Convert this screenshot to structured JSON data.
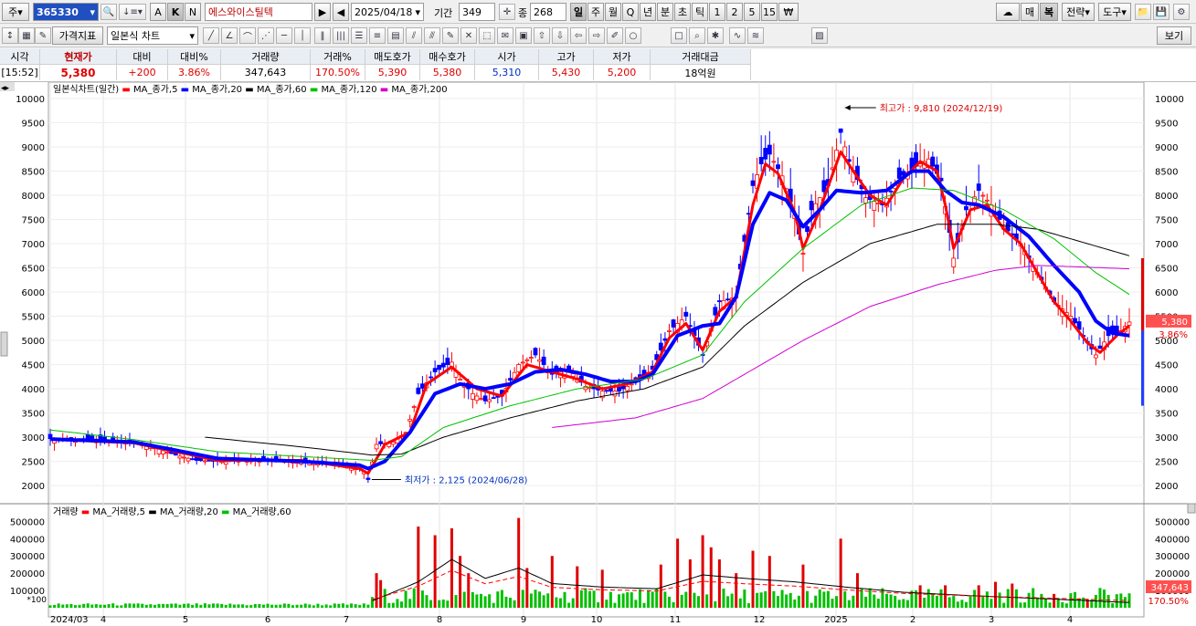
{
  "toolbar1": {
    "code_prefix": "주",
    "stock_code": "365330",
    "stock_name": "에스와이스틸텍",
    "date": "2025/04/18",
    "period_label": "기간",
    "period_value": "349",
    "jong_label": "종",
    "jong_value": "268",
    "buttons": [
      "A",
      "K",
      "N"
    ],
    "timeframes": [
      "일",
      "주",
      "월",
      "Q",
      "년",
      "분",
      "초",
      "틱",
      "1",
      "2",
      "5",
      "15",
      "₩"
    ],
    "right_buttons": [
      "매",
      "복",
      "전략",
      "도구"
    ]
  },
  "toolbar2": {
    "indicator_button": "가격지표",
    "chart_type_select": "일본식 차트",
    "view_button": "보기"
  },
  "quote": {
    "headers": [
      "시각",
      "현재가",
      "대비",
      "대비%",
      "거래량",
      "거래%",
      "매도호가",
      "매수호가",
      "시가",
      "고가",
      "저가",
      "거래대금"
    ],
    "values": [
      "[15:52]",
      "5,380",
      "+200",
      "3.86%",
      "347,643",
      "170.50%",
      "5,390",
      "5,380",
      "5,310",
      "5,430",
      "5,200",
      "18억원"
    ]
  },
  "price_legend": {
    "title": "일본식차트(일간)",
    "items": [
      {
        "name": "MA_종가,5",
        "color": "#ff0000"
      },
      {
        "name": "MA_종가,20",
        "color": "#0000ff"
      },
      {
        "name": "MA_종가,60",
        "color": "#000000"
      },
      {
        "name": "MA_종가,120",
        "color": "#00c000"
      },
      {
        "name": "MA_종가,200",
        "color": "#d000d0"
      }
    ]
  },
  "volume_legend": {
    "title": "거래량",
    "items": [
      {
        "name": "MA_거래량,5",
        "color": "#ff0000"
      },
      {
        "name": "MA_거래량,20",
        "color": "#000000"
      },
      {
        "name": "MA_거래량,60",
        "color": "#00c000"
      }
    ]
  },
  "annotations": {
    "high": "최고가 : 9,810 (2024/12/19)",
    "low": "최저가 : 2,125 (2024/06/28)",
    "current_price_tag": "5,380",
    "current_pct_tag": "3.86%",
    "current_volume_tag": "347,643",
    "volume_pct_tag": "170.50%",
    "volume_unit": "*100"
  },
  "chart_data": {
    "type": "candlestick",
    "x_tick_labels": [
      "2024/03",
      "4",
      "5",
      "6",
      "7",
      "8",
      "9",
      "10",
      "11",
      "12",
      "2025",
      "2",
      "3",
      "4"
    ],
    "y_ticks": [
      2000,
      2500,
      3000,
      3500,
      4000,
      4500,
      5000,
      5500,
      6000,
      6500,
      7000,
      7500,
      8000,
      8500,
      9000,
      9500,
      10000
    ],
    "ylim": [
      1700,
      10150
    ],
    "volume_ticks": [
      100000,
      200000,
      300000,
      400000,
      500000
    ],
    "volume_ylim": [
      0,
      560000
    ],
    "close_path": [
      [
        0,
        2970
      ],
      [
        10,
        2960
      ],
      [
        20,
        2880
      ],
      [
        25,
        2780
      ],
      [
        30,
        2630
      ],
      [
        35,
        2520
      ],
      [
        42,
        2490
      ],
      [
        48,
        2560
      ],
      [
        55,
        2530
      ],
      [
        62,
        2510
      ],
      [
        68,
        2470
      ],
      [
        73,
        2380
      ],
      [
        75,
        2300
      ],
      [
        76,
        2125
      ],
      [
        78,
        2850
      ],
      [
        82,
        2900
      ],
      [
        85,
        3100
      ],
      [
        88,
        3900
      ],
      [
        92,
        4350
      ],
      [
        96,
        4550
      ],
      [
        98,
        4200
      ],
      [
        101,
        3900
      ],
      [
        104,
        3750
      ],
      [
        108,
        3850
      ],
      [
        112,
        4500
      ],
      [
        116,
        4700
      ],
      [
        120,
        4300
      ],
      [
        124,
        4400
      ],
      [
        128,
        4050
      ],
      [
        132,
        3950
      ],
      [
        136,
        3950
      ],
      [
        140,
        4150
      ],
      [
        144,
        4400
      ],
      [
        148,
        5200
      ],
      [
        152,
        5500
      ],
      [
        156,
        4700
      ],
      [
        160,
        5800
      ],
      [
        164,
        5900
      ],
      [
        168,
        8200
      ],
      [
        170,
        8650
      ],
      [
        172,
        8850
      ],
      [
        175,
        8400
      ],
      [
        178,
        7600
      ],
      [
        180,
        6800
      ],
      [
        182,
        7700
      ],
      [
        186,
        8200
      ],
      [
        189,
        9300
      ],
      [
        191,
        8700
      ],
      [
        195,
        7950
      ],
      [
        199,
        7800
      ],
      [
        203,
        8350
      ],
      [
        207,
        8600
      ],
      [
        210,
        8750
      ],
      [
        213,
        8300
      ],
      [
        216,
        6700
      ],
      [
        219,
        7700
      ],
      [
        222,
        8100
      ],
      [
        225,
        7800
      ],
      [
        228,
        7350
      ],
      [
        232,
        7000
      ],
      [
        236,
        6400
      ],
      [
        240,
        5800
      ],
      [
        244,
        5500
      ],
      [
        248,
        4950
      ],
      [
        250,
        4700
      ],
      [
        253,
        5100
      ],
      [
        256,
        5200
      ],
      [
        258,
        5380
      ]
    ],
    "series": [
      {
        "name": "MA_종가,5",
        "color": "#ff0000",
        "points": [
          [
            0,
            2960
          ],
          [
            20,
            2880
          ],
          [
            40,
            2520
          ],
          [
            60,
            2520
          ],
          [
            74,
            2350
          ],
          [
            76,
            2250
          ],
          [
            80,
            2850
          ],
          [
            86,
            3100
          ],
          [
            90,
            4100
          ],
          [
            96,
            4450
          ],
          [
            102,
            4000
          ],
          [
            108,
            3850
          ],
          [
            114,
            4500
          ],
          [
            120,
            4350
          ],
          [
            126,
            4200
          ],
          [
            132,
            4000
          ],
          [
            138,
            4100
          ],
          [
            144,
            4350
          ],
          [
            148,
            5050
          ],
          [
            152,
            5350
          ],
          [
            156,
            4800
          ],
          [
            160,
            5600
          ],
          [
            164,
            5900
          ],
          [
            168,
            7800
          ],
          [
            171,
            8650
          ],
          [
            174,
            8450
          ],
          [
            178,
            7650
          ],
          [
            180,
            6900
          ],
          [
            184,
            7700
          ],
          [
            189,
            8900
          ],
          [
            192,
            8500
          ],
          [
            196,
            8000
          ],
          [
            200,
            7800
          ],
          [
            204,
            8350
          ],
          [
            208,
            8700
          ],
          [
            212,
            8500
          ],
          [
            214,
            7800
          ],
          [
            216,
            6900
          ],
          [
            220,
            7700
          ],
          [
            224,
            7800
          ],
          [
            228,
            7300
          ],
          [
            232,
            7000
          ],
          [
            236,
            6400
          ],
          [
            240,
            5800
          ],
          [
            244,
            5400
          ],
          [
            248,
            4950
          ],
          [
            251,
            4750
          ],
          [
            255,
            5100
          ],
          [
            258,
            5300
          ]
        ]
      },
      {
        "name": "MA_종가,20",
        "color": "#0000ff",
        "points": [
          [
            0,
            2960
          ],
          [
            20,
            2900
          ],
          [
            40,
            2560
          ],
          [
            60,
            2500
          ],
          [
            74,
            2420
          ],
          [
            76,
            2350
          ],
          [
            80,
            2500
          ],
          [
            86,
            3100
          ],
          [
            92,
            3900
          ],
          [
            98,
            4100
          ],
          [
            104,
            4000
          ],
          [
            110,
            4100
          ],
          [
            116,
            4350
          ],
          [
            122,
            4400
          ],
          [
            128,
            4300
          ],
          [
            134,
            4150
          ],
          [
            140,
            4150
          ],
          [
            144,
            4300
          ],
          [
            150,
            5100
          ],
          [
            156,
            5300
          ],
          [
            160,
            5350
          ],
          [
            164,
            5900
          ],
          [
            168,
            7400
          ],
          [
            172,
            8050
          ],
          [
            176,
            7900
          ],
          [
            180,
            7350
          ],
          [
            184,
            7700
          ],
          [
            188,
            8100
          ],
          [
            194,
            8050
          ],
          [
            200,
            8100
          ],
          [
            206,
            8500
          ],
          [
            210,
            8500
          ],
          [
            214,
            8100
          ],
          [
            218,
            7850
          ],
          [
            222,
            7800
          ],
          [
            228,
            7550
          ],
          [
            234,
            7150
          ],
          [
            240,
            6550
          ],
          [
            246,
            6000
          ],
          [
            250,
            5400
          ],
          [
            254,
            5150
          ],
          [
            258,
            5100
          ]
        ]
      },
      {
        "name": "MA_종가,60",
        "color": "#000000",
        "points": [
          [
            37,
            3000
          ],
          [
            60,
            2800
          ],
          [
            77,
            2630
          ],
          [
            84,
            2650
          ],
          [
            94,
            3000
          ],
          [
            110,
            3400
          ],
          [
            126,
            3750
          ],
          [
            142,
            4000
          ],
          [
            156,
            4450
          ],
          [
            166,
            5300
          ],
          [
            180,
            6200
          ],
          [
            196,
            7000
          ],
          [
            212,
            7400
          ],
          [
            226,
            7400
          ],
          [
            236,
            7300
          ],
          [
            246,
            7050
          ],
          [
            258,
            6750
          ]
        ]
      },
      {
        "name": "MA_종가,120",
        "color": "#00c000",
        "points": [
          [
            0,
            3150
          ],
          [
            20,
            2950
          ],
          [
            40,
            2700
          ],
          [
            60,
            2600
          ],
          [
            77,
            2520
          ],
          [
            84,
            2600
          ],
          [
            94,
            3200
          ],
          [
            110,
            3650
          ],
          [
            126,
            4000
          ],
          [
            142,
            4200
          ],
          [
            156,
            4700
          ],
          [
            166,
            5800
          ],
          [
            180,
            6900
          ],
          [
            194,
            7800
          ],
          [
            206,
            8150
          ],
          [
            216,
            8100
          ],
          [
            228,
            7700
          ],
          [
            240,
            7100
          ],
          [
            250,
            6400
          ],
          [
            258,
            5950
          ]
        ]
      },
      {
        "name": "MA_종가,200",
        "color": "#d000d0",
        "points": [
          [
            120,
            3200
          ],
          [
            140,
            3400
          ],
          [
            156,
            3800
          ],
          [
            166,
            4300
          ],
          [
            180,
            5000
          ],
          [
            196,
            5700
          ],
          [
            212,
            6150
          ],
          [
            226,
            6450
          ],
          [
            236,
            6550
          ],
          [
            246,
            6520
          ],
          [
            258,
            6480
          ]
        ]
      }
    ],
    "volume_spikes": [
      [
        78,
        200000
      ],
      [
        79,
        160000
      ],
      [
        88,
        470000
      ],
      [
        92,
        420000
      ],
      [
        96,
        460000
      ],
      [
        98,
        300000
      ],
      [
        100,
        200000
      ],
      [
        112,
        520000
      ],
      [
        114,
        230000
      ],
      [
        120,
        300000
      ],
      [
        126,
        240000
      ],
      [
        132,
        220000
      ],
      [
        146,
        250000
      ],
      [
        150,
        400000
      ],
      [
        153,
        280000
      ],
      [
        156,
        420000
      ],
      [
        158,
        350000
      ],
      [
        160,
        280000
      ],
      [
        164,
        200000
      ],
      [
        168,
        330000
      ],
      [
        172,
        300000
      ],
      [
        180,
        250000
      ],
      [
        189,
        400000
      ],
      [
        193,
        200000
      ],
      [
        208,
        130000
      ],
      [
        214,
        130000
      ],
      [
        222,
        130000
      ],
      [
        226,
        150000
      ],
      [
        230,
        140000
      ],
      [
        240,
        80000
      ],
      [
        248,
        50000
      ]
    ]
  }
}
